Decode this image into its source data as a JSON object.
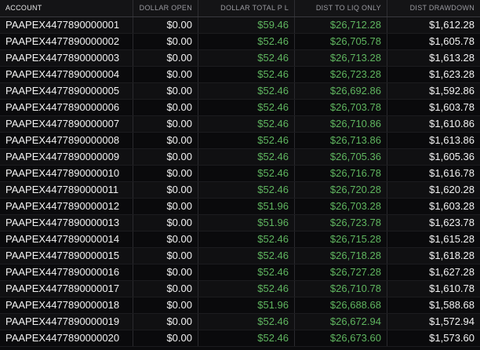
{
  "columns": {
    "account": "ACCOUNT",
    "dollar_open": "DOLLAR OPEN",
    "dollar_total_pl": "DOLLAR TOTAL P L",
    "dist_to_liq_only": "DIST TO LIQ ONLY",
    "dist_drawdown": "DIST DRAWDOWN"
  },
  "colors": {
    "positive": "#5fb55f",
    "text": "#f2f2f2",
    "header_text": "#9a9aa0",
    "background": "#0b0b0d"
  },
  "rows": [
    {
      "account": "PAAPEX4477890000001",
      "dollar_open": "$0.00",
      "dollar_total_pl": "$59.46",
      "dist_to_liq_only": "$26,712.28",
      "dist_drawdown": "$1,612.28"
    },
    {
      "account": "PAAPEX4477890000002",
      "dollar_open": "$0.00",
      "dollar_total_pl": "$52.46",
      "dist_to_liq_only": "$26,705.78",
      "dist_drawdown": "$1,605.78"
    },
    {
      "account": "PAAPEX4477890000003",
      "dollar_open": "$0.00",
      "dollar_total_pl": "$52.46",
      "dist_to_liq_only": "$26,713.28",
      "dist_drawdown": "$1,613.28"
    },
    {
      "account": "PAAPEX4477890000004",
      "dollar_open": "$0.00",
      "dollar_total_pl": "$52.46",
      "dist_to_liq_only": "$26,723.28",
      "dist_drawdown": "$1,623.28"
    },
    {
      "account": "PAAPEX4477890000005",
      "dollar_open": "$0.00",
      "dollar_total_pl": "$52.46",
      "dist_to_liq_only": "$26,692.86",
      "dist_drawdown": "$1,592.86"
    },
    {
      "account": "PAAPEX4477890000006",
      "dollar_open": "$0.00",
      "dollar_total_pl": "$52.46",
      "dist_to_liq_only": "$26,703.78",
      "dist_drawdown": "$1,603.78"
    },
    {
      "account": "PAAPEX4477890000007",
      "dollar_open": "$0.00",
      "dollar_total_pl": "$52.46",
      "dist_to_liq_only": "$26,710.86",
      "dist_drawdown": "$1,610.86"
    },
    {
      "account": "PAAPEX4477890000008",
      "dollar_open": "$0.00",
      "dollar_total_pl": "$52.46",
      "dist_to_liq_only": "$26,713.86",
      "dist_drawdown": "$1,613.86"
    },
    {
      "account": "PAAPEX4477890000009",
      "dollar_open": "$0.00",
      "dollar_total_pl": "$52.46",
      "dist_to_liq_only": "$26,705.36",
      "dist_drawdown": "$1,605.36"
    },
    {
      "account": "PAAPEX4477890000010",
      "dollar_open": "$0.00",
      "dollar_total_pl": "$52.46",
      "dist_to_liq_only": "$26,716.78",
      "dist_drawdown": "$1,616.78"
    },
    {
      "account": "PAAPEX4477890000011",
      "dollar_open": "$0.00",
      "dollar_total_pl": "$52.46",
      "dist_to_liq_only": "$26,720.28",
      "dist_drawdown": "$1,620.28"
    },
    {
      "account": "PAAPEX4477890000012",
      "dollar_open": "$0.00",
      "dollar_total_pl": "$51.96",
      "dist_to_liq_only": "$26,703.28",
      "dist_drawdown": "$1,603.28"
    },
    {
      "account": "PAAPEX4477890000013",
      "dollar_open": "$0.00",
      "dollar_total_pl": "$51.96",
      "dist_to_liq_only": "$26,723.78",
      "dist_drawdown": "$1,623.78"
    },
    {
      "account": "PAAPEX4477890000014",
      "dollar_open": "$0.00",
      "dollar_total_pl": "$52.46",
      "dist_to_liq_only": "$26,715.28",
      "dist_drawdown": "$1,615.28"
    },
    {
      "account": "PAAPEX4477890000015",
      "dollar_open": "$0.00",
      "dollar_total_pl": "$52.46",
      "dist_to_liq_only": "$26,718.28",
      "dist_drawdown": "$1,618.28"
    },
    {
      "account": "PAAPEX4477890000016",
      "dollar_open": "$0.00",
      "dollar_total_pl": "$52.46",
      "dist_to_liq_only": "$26,727.28",
      "dist_drawdown": "$1,627.28"
    },
    {
      "account": "PAAPEX4477890000017",
      "dollar_open": "$0.00",
      "dollar_total_pl": "$52.46",
      "dist_to_liq_only": "$26,710.78",
      "dist_drawdown": "$1,610.78"
    },
    {
      "account": "PAAPEX4477890000018",
      "dollar_open": "$0.00",
      "dollar_total_pl": "$51.96",
      "dist_to_liq_only": "$26,688.68",
      "dist_drawdown": "$1,588.68"
    },
    {
      "account": "PAAPEX4477890000019",
      "dollar_open": "$0.00",
      "dollar_total_pl": "$52.46",
      "dist_to_liq_only": "$26,672.94",
      "dist_drawdown": "$1,572.94"
    },
    {
      "account": "PAAPEX4477890000020",
      "dollar_open": "$0.00",
      "dollar_total_pl": "$52.46",
      "dist_to_liq_only": "$26,673.60",
      "dist_drawdown": "$1,573.60"
    }
  ]
}
